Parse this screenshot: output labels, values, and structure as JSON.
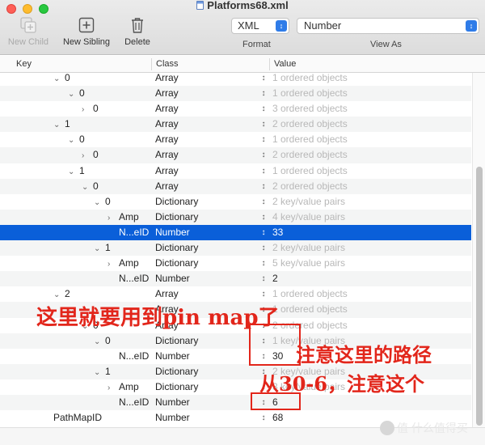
{
  "window": {
    "title": "Platforms68.xml"
  },
  "toolbar": {
    "new_child": "New Child",
    "new_sibling": "New Sibling",
    "delete": "Delete",
    "format_value": "XML",
    "format_caption": "Format",
    "viewas_value": "Number",
    "viewas_caption": "View As"
  },
  "table": {
    "headers": {
      "key": "Key",
      "class": "Class",
      "value": "Value"
    },
    "rows": [
      {
        "key": "0",
        "class": "Array",
        "value": "1 ordered objects"
      },
      {
        "key": "0",
        "class": "Array",
        "value": "1 ordered objects"
      },
      {
        "key": "0",
        "class": "Array",
        "value": "3 ordered objects"
      },
      {
        "key": "1",
        "class": "Array",
        "value": "2 ordered objects"
      },
      {
        "key": "0",
        "class": "Array",
        "value": "1 ordered objects"
      },
      {
        "key": "0",
        "class": "Array",
        "value": "2 ordered objects"
      },
      {
        "key": "1",
        "class": "Array",
        "value": "1 ordered objects"
      },
      {
        "key": "0",
        "class": "Array",
        "value": "2 ordered objects"
      },
      {
        "key": "0",
        "class": "Dictionary",
        "value": "2 key/value pairs"
      },
      {
        "key": "Amp",
        "class": "Dictionary",
        "value": "4 key/value pairs"
      },
      {
        "key": "N...eID",
        "class": "Number",
        "value": "33"
      },
      {
        "key": "1",
        "class": "Dictionary",
        "value": "2 key/value pairs"
      },
      {
        "key": "Amp",
        "class": "Dictionary",
        "value": "5 key/value pairs"
      },
      {
        "key": "N...eID",
        "class": "Number",
        "value": "2"
      },
      {
        "key": "2",
        "class": "Array",
        "value": "1 ordered objects"
      },
      {
        "key": "",
        "class": "Array",
        "value": "1 ordered objects"
      },
      {
        "key": "0",
        "class": "Array",
        "value": "2 ordered objects"
      },
      {
        "key": "0",
        "class": "Dictionary",
        "value": "1 key/value pairs"
      },
      {
        "key": "N...eID",
        "class": "Number",
        "value": "30"
      },
      {
        "key": "1",
        "class": "Dictionary",
        "value": "2 key/value pairs"
      },
      {
        "key": "Amp",
        "class": "Dictionary",
        "value": "3 key/value pairs"
      },
      {
        "key": "N...eID",
        "class": "Number",
        "value": "6"
      },
      {
        "key": "PathMapID",
        "class": "Number",
        "value": "68"
      }
    ]
  },
  "annotations": {
    "a1": "这里就要用到pin map了",
    "a2": "注意这里的路径",
    "a3": "从30-6，注意这个"
  },
  "watermark": "值 什么值得买",
  "colors": {
    "selection": "#0a5fd9",
    "annotation": "#e2261b",
    "accent": "#2f7ce8"
  }
}
